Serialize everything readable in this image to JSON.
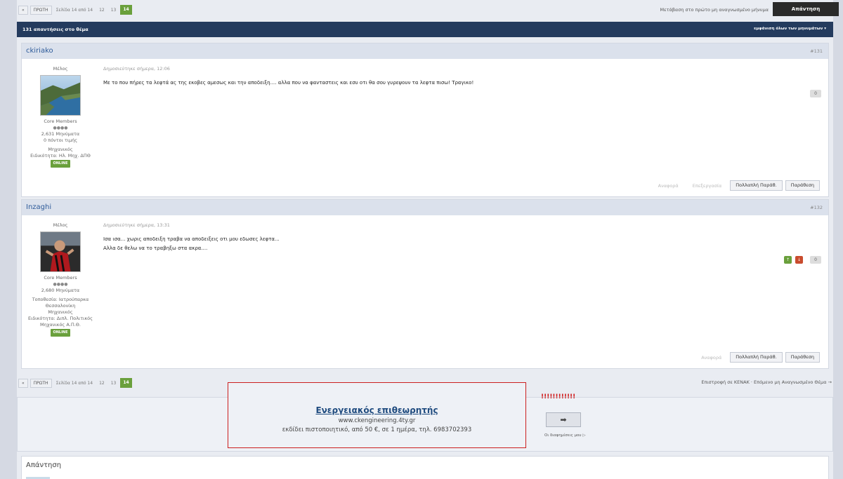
{
  "pager": {
    "prev": "«",
    "first_btn": "ΠΡΩΤΗ",
    "page_info": "Σελίδα 14 από 14",
    "pages": [
      "12",
      "13"
    ],
    "active": "14"
  },
  "header": {
    "follow_text": "Μετάβαση στο πρώτο μη αναγνωσμένο μήνυμα",
    "reply_button": "Απάντηση"
  },
  "thread_bar": {
    "count_text": "131 απαντήσεις στο θέμα",
    "options": "εμφάνιση όλων των μηνυμάτων",
    "options_arrow": "▾"
  },
  "posts": [
    {
      "author": "ckiriako",
      "number": "#131",
      "role": "Μέλος",
      "group": "Core Members",
      "stars": "●●●●",
      "messages": "2,631 Μηνύματα",
      "points": "0 πόντοι τιμής",
      "job": "Μηχανικός",
      "specialty": "Ειδικότητα: Ηλ. Μηχ. ΔΠΘ",
      "status": "ONLINE",
      "date": "Δημοσιεύτηκε σήμερα, 12:06",
      "body_lines": [
        "Με το που πήρες τα λεφτά ας της εκοβες αμεσως και την αποδειξη.... αλλα που να φανταστεις και εσυ οτι θα σου γυρεψουν τα λεφτα πισω! Τραγικο!"
      ],
      "vote_count": "0",
      "actions": {
        "report": "Αναφορά",
        "edit": "Επεξεργασία",
        "multiquote": "Πολλαπλή Παράθ.",
        "quote": "Παράθεση"
      }
    },
    {
      "author": "Inzaghi",
      "number": "#132",
      "role": "Μέλος",
      "group": "Core Members",
      "stars": "●●●●",
      "messages": "2,680 Μηνύματα",
      "location": "Τοποθεσία: Ιατρούπαρκα Θεσσαλονίκη",
      "job": "Μηχανικός",
      "specialty": "Ειδικότητα: Διπλ. Πολιτικός Μηχανικός Α.Π.Θ.",
      "status": "ONLINE",
      "date": "Δημοσιεύτηκε σήμερα, 13:31",
      "body_lines": [
        "Ισα ισα... χωρις αποδειξη τραβα να αποδειξεις οτι μου εδωσες λεφτα...",
        "Αλλα δε θελω να το τραβηξω στα ακρα...."
      ],
      "vote_up": "↑",
      "vote_down": "↓",
      "vote_count": "0",
      "actions": {
        "report": "Αναφορά",
        "multiquote": "Πολλαπλή Παράθ.",
        "quote": "Παράθεση"
      }
    }
  ],
  "bottom_links": "Επιστροφή σε ΚΕΝΑΚ · Επόμενο μη Αναγνωσμένο Θέμα →",
  "ad": {
    "title": "Ενεργειακός επιθεωρητής",
    "url": "www.ckengineering.4ty.gr",
    "desc": "εκδίδει πιστοποιητικό, από 50 €, σε 1 ημέρα, τηλ. 6983702393",
    "exclaim": "!!!!!!!!!!!!",
    "arrow": "➡",
    "caption": "Οι διαφημίσεις μου ▷"
  },
  "reply_panel": {
    "label": "Απάντηση"
  },
  "colors": {
    "thread_bar": "#243b5e",
    "online": "#6aa03c",
    "ad_border": "#cc1f1f",
    "author": "#2e5b9a"
  }
}
